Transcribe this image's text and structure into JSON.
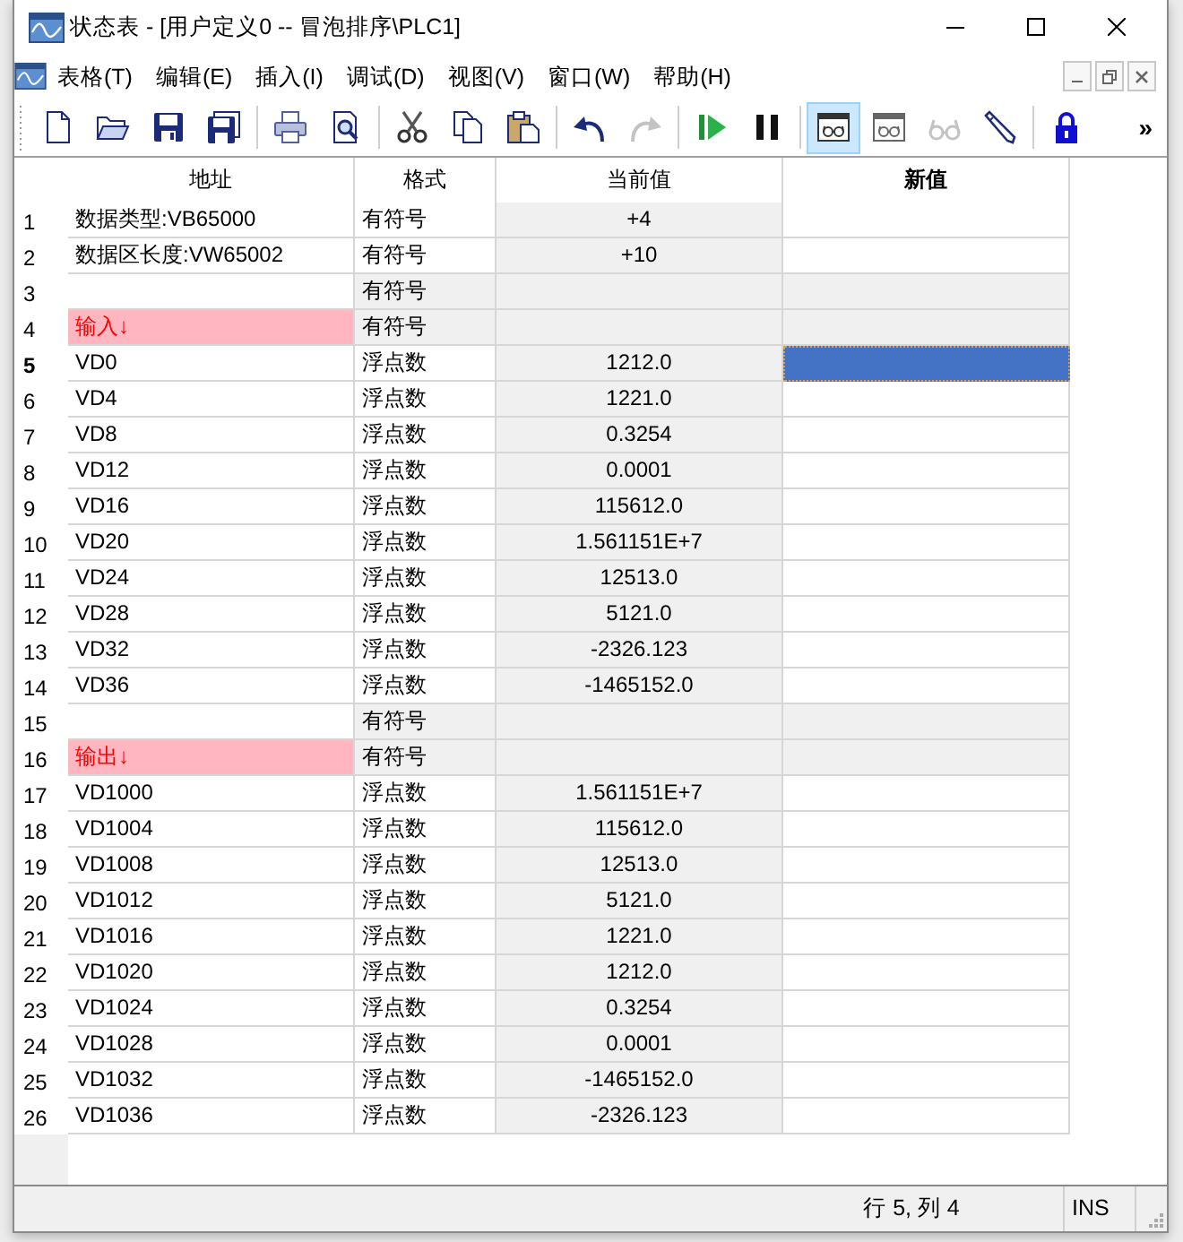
{
  "window": {
    "title": "状态表 - [用户定义0 -- 冒泡排序\\PLC1]"
  },
  "menu_bar": {
    "items": [
      "表格(T)",
      "编辑(E)",
      "插入(I)",
      "调试(D)",
      "视图(V)",
      "窗口(W)",
      "帮助(H)"
    ]
  },
  "toolbar": {
    "groups": [
      [
        {
          "kind": "new",
          "disabled": false,
          "selected": false
        },
        {
          "kind": "open",
          "disabled": false,
          "selected": false
        },
        {
          "kind": "save",
          "disabled": false,
          "selected": false
        },
        {
          "kind": "save_all",
          "disabled": false,
          "selected": false
        }
      ],
      [
        {
          "kind": "print",
          "disabled": false,
          "selected": false
        },
        {
          "kind": "preview",
          "disabled": false,
          "selected": false
        }
      ],
      [
        {
          "kind": "cut",
          "disabled": false,
          "selected": false
        },
        {
          "kind": "copy",
          "disabled": false,
          "selected": false
        },
        {
          "kind": "paste",
          "disabled": false,
          "selected": false
        }
      ],
      [
        {
          "kind": "undo",
          "disabled": false,
          "selected": false
        },
        {
          "kind": "redo",
          "disabled": true,
          "selected": false
        }
      ],
      [
        {
          "kind": "run",
          "disabled": false,
          "selected": false
        },
        {
          "kind": "pause",
          "disabled": false,
          "selected": false
        }
      ],
      [
        {
          "kind": "status_chart",
          "disabled": false,
          "selected": true
        },
        {
          "kind": "trend",
          "disabled": false,
          "selected": false
        },
        {
          "kind": "glasses",
          "disabled": true,
          "selected": false
        },
        {
          "kind": "pencil",
          "disabled": false,
          "selected": false
        }
      ],
      [
        {
          "kind": "lock",
          "disabled": false,
          "selected": false
        }
      ]
    ],
    "overflow": "»"
  },
  "table": {
    "columns": [
      {
        "label": "地址",
        "selected": false
      },
      {
        "label": "格式",
        "selected": false
      },
      {
        "label": "当前值",
        "selected": false
      },
      {
        "label": "新值",
        "selected": true
      }
    ],
    "rows": [
      {
        "number": "1",
        "kind": "data",
        "address": "数据类型:VB65000",
        "format": "有符号",
        "current_value": "+4",
        "selected": false
      },
      {
        "number": "2",
        "kind": "data",
        "address": "数据区长度:VW65002",
        "format": "有符号",
        "current_value": "+10",
        "selected": false
      },
      {
        "number": "3",
        "kind": "blank",
        "format": "有符号",
        "selected": false
      },
      {
        "number": "4",
        "kind": "marker",
        "address": "输入↓",
        "format": "有符号",
        "selected": false
      },
      {
        "number": "5",
        "kind": "data",
        "address": "VD0",
        "format": "浮点数",
        "current_value": "1212.0",
        "selected": true
      },
      {
        "number": "6",
        "kind": "data",
        "address": "VD4",
        "format": "浮点数",
        "current_value": "1221.0",
        "selected": false
      },
      {
        "number": "7",
        "kind": "data",
        "address": "VD8",
        "format": "浮点数",
        "current_value": "0.3254",
        "selected": false
      },
      {
        "number": "8",
        "kind": "data",
        "address": "VD12",
        "format": "浮点数",
        "current_value": "0.0001",
        "selected": false
      },
      {
        "number": "9",
        "kind": "data",
        "address": "VD16",
        "format": "浮点数",
        "current_value": "115612.0",
        "selected": false
      },
      {
        "number": "10",
        "kind": "data",
        "address": "VD20",
        "format": "浮点数",
        "current_value": "1.561151E+7",
        "selected": false
      },
      {
        "number": "11",
        "kind": "data",
        "address": "VD24",
        "format": "浮点数",
        "current_value": "12513.0",
        "selected": false
      },
      {
        "number": "12",
        "kind": "data",
        "address": "VD28",
        "format": "浮点数",
        "current_value": "5121.0",
        "selected": false
      },
      {
        "number": "13",
        "kind": "data",
        "address": "VD32",
        "format": "浮点数",
        "current_value": "-2326.123",
        "selected": false
      },
      {
        "number": "14",
        "kind": "data",
        "address": "VD36",
        "format": "浮点数",
        "current_value": "-1465152.0",
        "selected": false
      },
      {
        "number": "15",
        "kind": "blank",
        "format": "有符号",
        "selected": false
      },
      {
        "number": "16",
        "kind": "marker",
        "address": "输出↓",
        "format": "有符号",
        "selected": false
      },
      {
        "number": "17",
        "kind": "data",
        "address": "VD1000",
        "format": "浮点数",
        "current_value": "1.561151E+7",
        "selected": false
      },
      {
        "number": "18",
        "kind": "data",
        "address": "VD1004",
        "format": "浮点数",
        "current_value": "115612.0",
        "selected": false
      },
      {
        "number": "19",
        "kind": "data",
        "address": "VD1008",
        "format": "浮点数",
        "current_value": "12513.0",
        "selected": false
      },
      {
        "number": "20",
        "kind": "data",
        "address": "VD1012",
        "format": "浮点数",
        "current_value": "5121.0",
        "selected": false
      },
      {
        "number": "21",
        "kind": "data",
        "address": "VD1016",
        "format": "浮点数",
        "current_value": "1221.0",
        "selected": false
      },
      {
        "number": "22",
        "kind": "data",
        "address": "VD1020",
        "format": "浮点数",
        "current_value": "1212.0",
        "selected": false
      },
      {
        "number": "23",
        "kind": "data",
        "address": "VD1024",
        "format": "浮点数",
        "current_value": "0.3254",
        "selected": false
      },
      {
        "number": "24",
        "kind": "data",
        "address": "VD1028",
        "format": "浮点数",
        "current_value": "0.0001",
        "selected": false
      },
      {
        "number": "25",
        "kind": "data",
        "address": "VD1032",
        "format": "浮点数",
        "current_value": "-1465152.0",
        "selected": false
      },
      {
        "number": "26",
        "kind": "data",
        "address": "VD1036",
        "format": "浮点数",
        "current_value": "-2326.123",
        "selected": false
      }
    ]
  },
  "status_bar": {
    "position": "行 5, 列 4",
    "mode": "INS"
  }
}
